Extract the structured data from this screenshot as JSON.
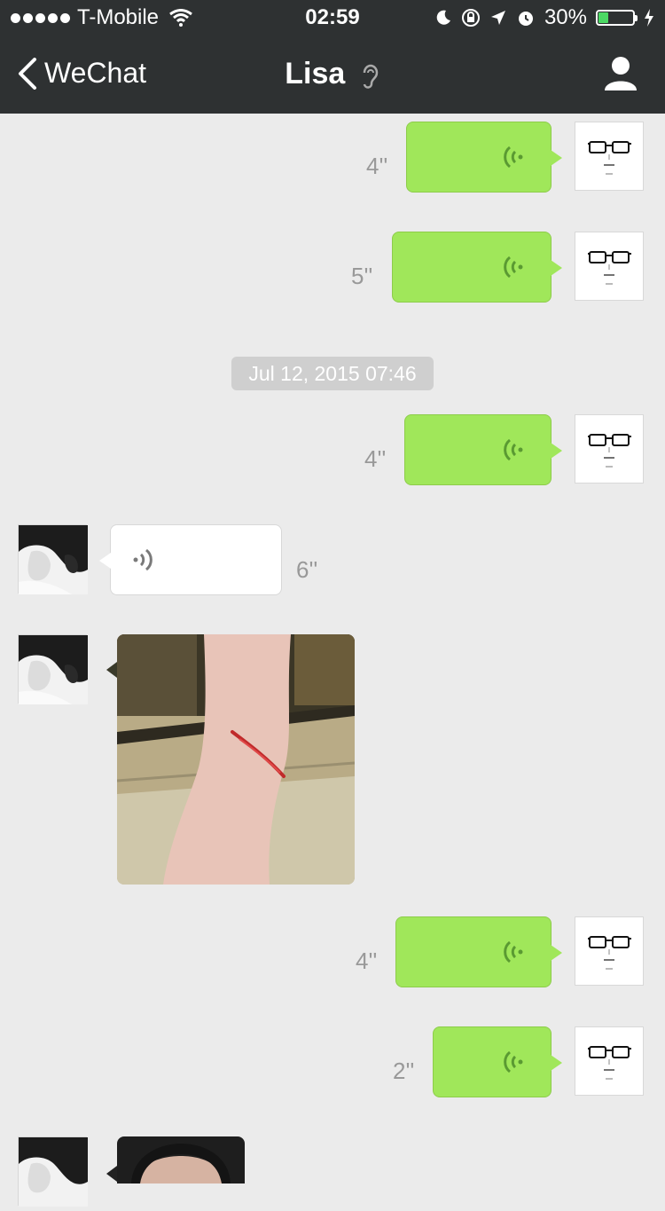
{
  "status": {
    "carrier": "T-Mobile",
    "time": "02:59",
    "battery": "30%",
    "battery_level": 0.3,
    "battery_color": "#4cd964"
  },
  "nav": {
    "back_label": "WeChat",
    "title": "Lisa",
    "icons": [
      "chevron-left-icon",
      "ear-icon",
      "profile-icon"
    ]
  },
  "timestamp": "Jul 12, 2015 07:46",
  "messages": [
    {
      "side": "right",
      "type": "voice",
      "duration": "4''"
    },
    {
      "side": "right",
      "type": "voice",
      "duration": "5''"
    },
    {
      "side": "right",
      "type": "voice",
      "duration": "4''"
    },
    {
      "side": "left",
      "type": "voice",
      "duration": "6''"
    },
    {
      "side": "left",
      "type": "image"
    },
    {
      "side": "right",
      "type": "voice",
      "duration": "4''"
    },
    {
      "side": "right",
      "type": "voice",
      "duration": "2''"
    },
    {
      "side": "left",
      "type": "image"
    }
  ],
  "colors": {
    "sent_bubble": "#a0e75a",
    "received_bubble": "#ffffff",
    "background": "#ebebeb",
    "topbar": "#2e3132"
  }
}
